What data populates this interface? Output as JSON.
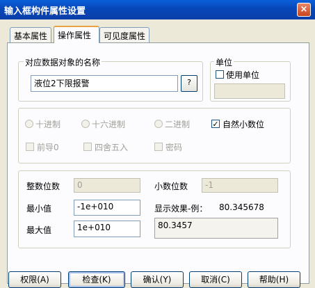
{
  "window": {
    "title": "输入框构件属性设置",
    "close_glyph": "×"
  },
  "tabs": [
    {
      "label": "基本属性",
      "active": false
    },
    {
      "label": "操作属性",
      "active": true
    },
    {
      "label": "可见度属性",
      "active": false
    }
  ],
  "data_object": {
    "legend": "对应数据对象的名称",
    "value": "液位2下限报警",
    "browse_label": "?"
  },
  "unit": {
    "legend": "单位",
    "use_unit_label": "使用单位",
    "use_unit_checked": false,
    "value": ""
  },
  "format": {
    "decimal_label": "十进制",
    "hex_label": "十六进制",
    "binary_label": "二进制",
    "natural_decimal_label": "自然小数位",
    "natural_decimal_checked": true,
    "check_mark": "✓",
    "leading_zero_label": "前导0",
    "round_label": "四舍五入",
    "password_label": "密码"
  },
  "range": {
    "integer_digits_label": "整数位数",
    "integer_digits_value": "0",
    "decimal_digits_label": "小数位数",
    "decimal_digits_value": "-1",
    "min_label": "最小值",
    "min_value": "-1e+010",
    "max_label": "最大值",
    "max_value": "1e+010",
    "preview_label": "显示效果-例：",
    "preview_sample": "80.345678",
    "preview_result": "80.3457"
  },
  "buttons": {
    "permission": "权限(A)",
    "check": "检查(K)",
    "confirm": "确认(Y)",
    "cancel": "取消(C)",
    "help": "帮助(H)"
  }
}
